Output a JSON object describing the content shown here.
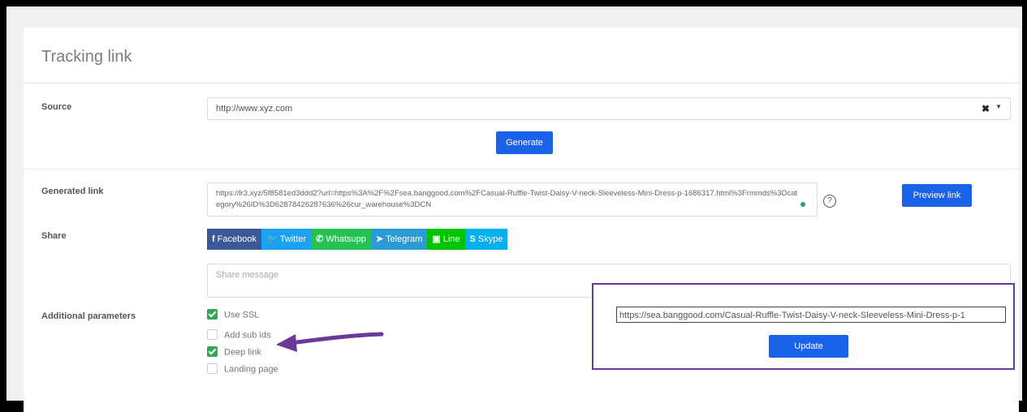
{
  "card": {
    "title": "Tracking link"
  },
  "source": {
    "label": "Source",
    "value": "http://www.xyz.com",
    "clear_glyph": "✖",
    "caret_glyph": "▼"
  },
  "generate_label": "Generate",
  "generated": {
    "label": "Generated link",
    "value": "https://lr3.xyz/5f8581ed3ddd2?url=https%3A%2F%2Fsea.banggood.com%2FCasual-Ruffle-Twist-Daisy-V-neck-Sleeveless-Mini-Dress-p-1686317.html%3Frmmds%3Dcategory%26ID%3D62878426287636%26cur_warehouse%3DCN",
    "help_glyph": "?",
    "preview_label": "Preview link"
  },
  "share": {
    "label": "Share",
    "buttons": [
      {
        "icon": "f",
        "label": "Facebook",
        "color": "#3b5998"
      },
      {
        "icon": "🐦",
        "label": "Twitter",
        "color": "#1da1f2"
      },
      {
        "icon": "✆",
        "label": "Whatsupp",
        "color": "#25c253"
      },
      {
        "icon": "➤",
        "label": "Telegram",
        "color": "#2a9bd6"
      },
      {
        "icon": "▣",
        "label": "Line",
        "color": "#00c300"
      },
      {
        "icon": "S",
        "label": "Skype",
        "color": "#00aff0"
      }
    ],
    "message_placeholder": "Share message"
  },
  "additional": {
    "label": "Additional parameters",
    "options": [
      {
        "label": "Use SSL",
        "checked": true
      },
      {
        "label": "Add sub ids",
        "checked": false
      },
      {
        "label": "Deep link",
        "checked": true
      },
      {
        "label": "Landing page",
        "checked": false
      }
    ]
  },
  "deep_link_popup": {
    "url": "https://sea.banggood.com/Casual-Ruffle-Twist-Daisy-V-neck-Sleeveless-Mini-Dress-p-1",
    "update_label": "Update"
  },
  "colors": {
    "primary": "#1a63e8",
    "check": "#2eaa55",
    "highlight_box": "#6a3a9a",
    "arrow": "#6a3a9a"
  }
}
